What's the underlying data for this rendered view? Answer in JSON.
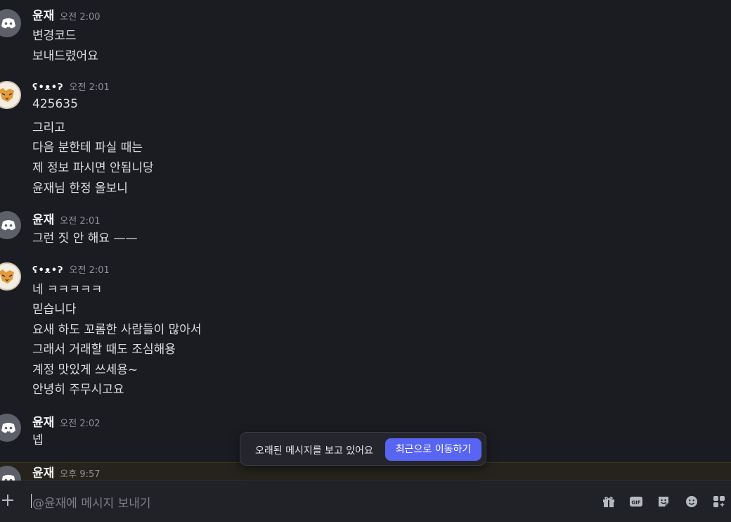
{
  "messages": [
    {
      "author": "윤재",
      "timestamp": "오전 2:00",
      "avatar": "discord-icon",
      "lines": [
        "변경코드",
        "보내드렸어요"
      ]
    },
    {
      "author": "ʕ•ᴥ•ʔ",
      "timestamp": "오전 2:01",
      "avatar": "fox",
      "lines": [
        "425635",
        "그리고",
        "다음 분한테 파실 때는",
        "제 정보 파시면 안됩니당",
        "윤재님 한정 올보니"
      ]
    },
    {
      "author": "윤재",
      "timestamp": "오전 2:01",
      "avatar": "discord-icon",
      "lines": [
        "그런 짓 안 해요 ——"
      ]
    },
    {
      "author": "ʕ•ᴥ•ʔ",
      "timestamp": "오전 2:01",
      "avatar": "fox",
      "lines": [
        "네 ㅋㅋㅋㅋㅋ",
        "믿습니다",
        "요새 하도 꼬롬한 사람들이 많아서",
        "그래서 거래할 때도 조심해용",
        "계정 맛있게 쓰세용~",
        "안녕히 주무시고요"
      ]
    },
    {
      "author": "윤재",
      "timestamp": "오전 2:02",
      "avatar": "discord-icon",
      "lines": [
        "넵"
      ]
    },
    {
      "author": "윤재",
      "timestamp": "오후 9:57",
      "avatar": "discord-icon",
      "lines": []
    }
  ],
  "jump_bar": {
    "text": "오래된 메시지를 보고 있어요",
    "button": "최근으로 이동하기"
  },
  "composer": {
    "placeholder": "@윤재에 메시지 보내기"
  },
  "colors": {
    "accent": "#5865f2",
    "background": "#1b1c22",
    "highlight": "#25231c"
  }
}
